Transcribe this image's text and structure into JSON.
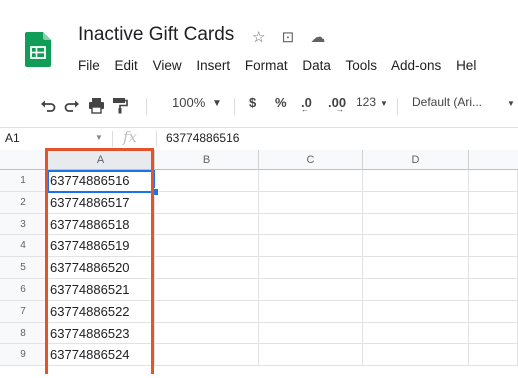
{
  "doc": {
    "title": "Inactive Gift Cards"
  },
  "title_icons": [
    "star-icon",
    "move-to-folder-icon",
    "cloud-status-icon"
  ],
  "menu": [
    "File",
    "Edit",
    "View",
    "Insert",
    "Format",
    "Data",
    "Tools",
    "Add-ons",
    "Hel"
  ],
  "toolbar": {
    "zoom": "100%",
    "currency": "$",
    "percent": "%",
    "dec_decrease": ".0",
    "dec_increase": ".00",
    "number_format": "123",
    "font": "Default (Ari..."
  },
  "formula_bar": {
    "cell_ref": "A1",
    "fx": "fx",
    "value": "63774886516"
  },
  "grid": {
    "columns": [
      "A",
      "B",
      "C",
      "D"
    ],
    "rows": [
      {
        "n": "1",
        "a": "63774886516"
      },
      {
        "n": "2",
        "a": "63774886517"
      },
      {
        "n": "3",
        "a": "63774886518"
      },
      {
        "n": "4",
        "a": "63774886519"
      },
      {
        "n": "5",
        "a": "63774886520"
      },
      {
        "n": "6",
        "a": "63774886521"
      },
      {
        "n": "7",
        "a": "63774886522"
      },
      {
        "n": "8",
        "a": "63774886523"
      },
      {
        "n": "9",
        "a": "63774886524"
      }
    ]
  },
  "colors": {
    "highlight": "#e3542a",
    "selection": "#1a73e8",
    "sheets_green": "#0f9d58"
  }
}
